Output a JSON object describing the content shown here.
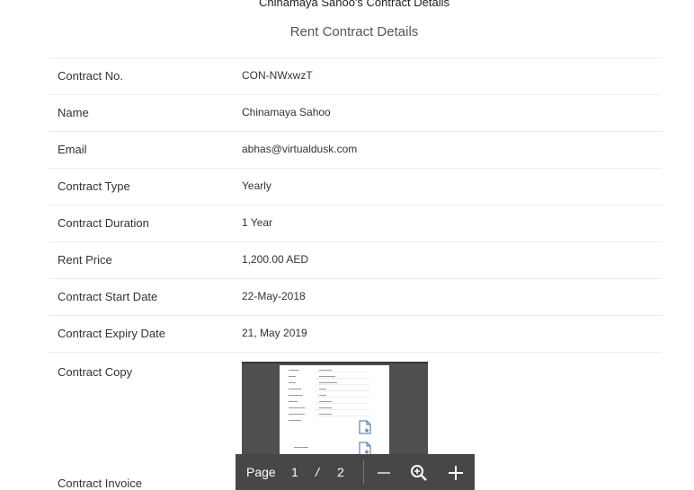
{
  "header": {
    "owner_title": "Chinamaya Sahoo's Contract Details",
    "section_title": "Rent Contract Details"
  },
  "details": [
    {
      "label": "Contract No.",
      "value": "CON-NWxwzT"
    },
    {
      "label": "Name",
      "value": "Chinamaya Sahoo"
    },
    {
      "label": "Email",
      "value": "abhas@virtualdusk.com"
    },
    {
      "label": "Contract Type",
      "value": "Yearly"
    },
    {
      "label": "Contract Duration",
      "value": "1 Year"
    },
    {
      "label": "Rent Price",
      "value": "1,200.00 AED"
    },
    {
      "label": "Contract Start Date",
      "value": "22-May-2018"
    },
    {
      "label": "Contract Expiry Date",
      "value": "21, May 2019"
    }
  ],
  "copy_label": "Contract Copy",
  "invoice_label": "Contract Invoice",
  "pdf_viewer": {
    "page_label": "Page",
    "current_page": "1",
    "separator": "/",
    "total_pages": "2",
    "icons": [
      "minus-icon",
      "zoom-in-icon",
      "plus-icon"
    ],
    "thumbnail_caption": "Contract Invoice"
  }
}
